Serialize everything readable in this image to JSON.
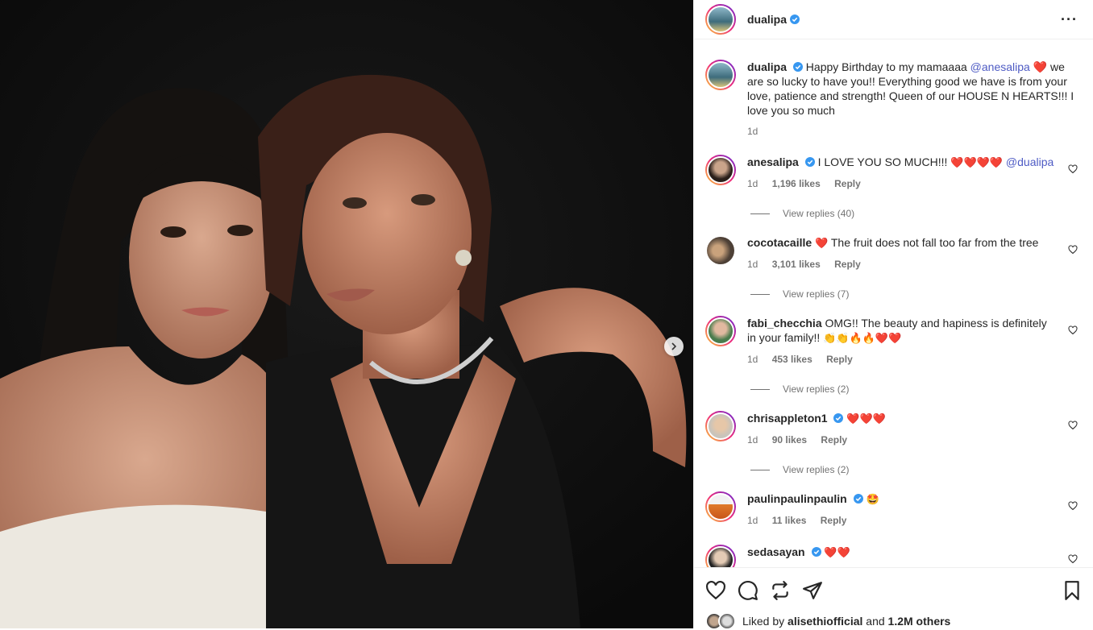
{
  "post": {
    "username": "dualipa",
    "caption_prefix": "Happy Birthday to my mamaaaa",
    "caption_mention": "@anesalipa",
    "caption_rest": "we are so lucky to have you!! Everything good we have is from your love, patience and strength! Queen of our HOUSE N HEARTS!!! I love you so much",
    "time": "1d"
  },
  "comments": [
    {
      "user": "anesalipa",
      "verified": true,
      "text": "I LOVE YOU SO MUCH!!!",
      "emojis": "❤️❤️❤️❤️",
      "mention": "@dualipa",
      "time": "1d",
      "likes": "1,196 likes",
      "reply": "Reply",
      "view_replies": "View replies (40)"
    },
    {
      "user": "cocotacaille",
      "verified": false,
      "pre_emoji": "❤️",
      "text": "The fruit does not fall too far from the tree",
      "time": "1d",
      "likes": "3,101 likes",
      "reply": "Reply",
      "view_replies": "View replies (7)"
    },
    {
      "user": "fabi_checchia",
      "verified": false,
      "text": "OMG!! The beauty and hapiness is definitely in your family!!",
      "emojis": "👏👏🔥🔥❤️❤️",
      "time": "1d",
      "likes": "453 likes",
      "reply": "Reply",
      "view_replies": "View replies (2)"
    },
    {
      "user": "chrisappleton1",
      "verified": true,
      "emojis": "❤️❤️❤️",
      "time": "1d",
      "likes": "90 likes",
      "reply": "Reply",
      "view_replies": "View replies (2)"
    },
    {
      "user": "paulinpaulinpaulin",
      "verified": true,
      "emojis": "🤩",
      "time": "1d",
      "likes": "11 likes",
      "reply": "Reply"
    },
    {
      "user": "sedasayan",
      "verified": true,
      "emojis": "❤️❤️"
    }
  ],
  "liked_by": {
    "prefix": "Liked by",
    "user": "alisethiofficial",
    "middle": "and",
    "others": "1.2M others"
  },
  "icons": [
    "heart-icon",
    "comment-icon",
    "share-icon",
    "send-icon",
    "save-icon",
    "more-icon",
    "chevron-right-icon",
    "verified-icon"
  ],
  "colors": {
    "accent": "#4e5bc4",
    "verified": "#3797f0",
    "heart": "#e0242a"
  }
}
